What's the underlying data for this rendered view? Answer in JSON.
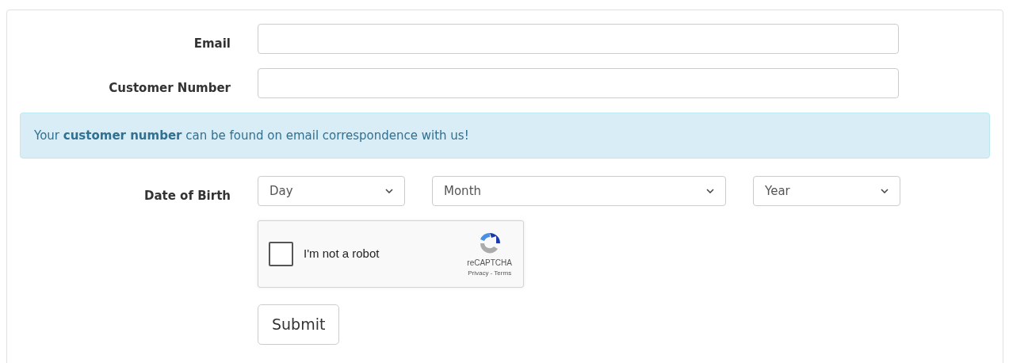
{
  "fields": [
    {
      "label": "Email"
    },
    {
      "label": "Customer Number"
    }
  ],
  "info_alert": "Your **customer number** can be found on email correspondence with us!",
  "date_of_birth": {
    "label": "Date of Birth",
    "selects": [
      {
        "value": "Day"
      },
      {
        "value": "Month"
      },
      {
        "value": "Year"
      }
    ]
  },
  "captcha": {
    "label": "I'm not a robot",
    "checked": false,
    "brand": "reCAPTCHA",
    "links": "Privacy - Terms"
  },
  "submit": "Submit"
}
